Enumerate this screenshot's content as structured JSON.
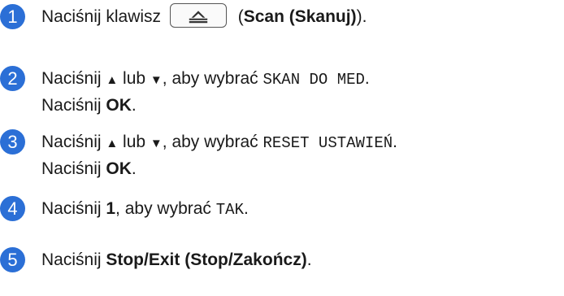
{
  "steps": [
    {
      "num": "1",
      "lines": [
        {
          "t1": "Naciśnij klawisz ",
          "key_icon": "scan-icon",
          "t2": " (",
          "bold": "Scan (Skanuj)",
          "t3": ")."
        }
      ]
    },
    {
      "num": "2",
      "line1": {
        "t1": "Naciśnij ",
        "up": "▲",
        "t2": " lub ",
        "down": "▼",
        "t3": ", aby wybrać ",
        "mono": "SKAN DO MED",
        "t4": "."
      },
      "line2": {
        "t1": "Naciśnij ",
        "bold": "OK",
        "t2": "."
      }
    },
    {
      "num": "3",
      "line1": {
        "t1": "Naciśnij ",
        "up": "▲",
        "t2": " lub ",
        "down": "▼",
        "t3": ", aby wybrać ",
        "mono": "RESET USTAWIEŃ",
        "t4": "."
      },
      "line2": {
        "t1": "Naciśnij ",
        "bold": "OK",
        "t2": "."
      }
    },
    {
      "num": "4",
      "line1": {
        "t1": "Naciśnij ",
        "bold": "1",
        "t2": ", aby wybrać ",
        "mono": "TAK",
        "t3": "."
      }
    },
    {
      "num": "5",
      "line1": {
        "t1": "Naciśnij ",
        "bold": "Stop/Exit (Stop/Zakończ)",
        "t2": "."
      }
    }
  ],
  "colors": {
    "step_badge": "#2b6fd6"
  }
}
